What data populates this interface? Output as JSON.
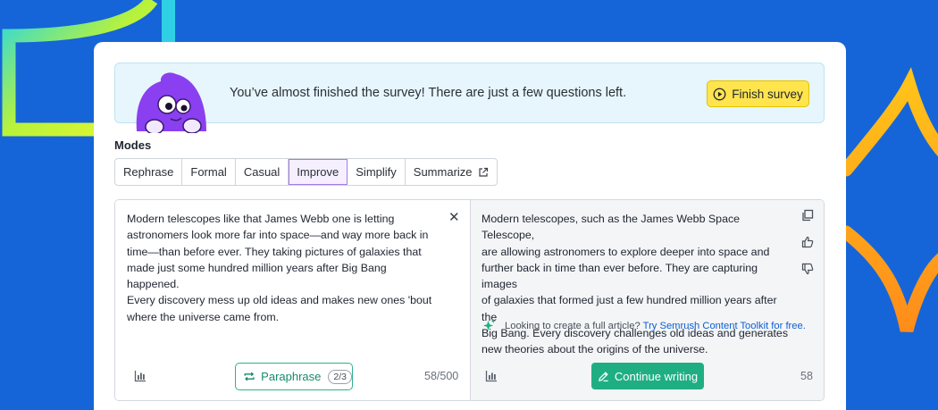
{
  "colors": {
    "background": "#1565d8",
    "finish_button": "#ffe44d",
    "paraphrase_accent": "#158a6b",
    "continue_button": "#1fae82",
    "active_mode": "#a47be8",
    "link": "#0b5fd6"
  },
  "banner": {
    "message": "You’ve almost finished the survey! There are just a few questions left.",
    "finish_label": "Finish survey",
    "finish_icon": "play-circle-icon",
    "mascot": "purple-mascot-illustration"
  },
  "modes": {
    "title": "Modes",
    "items": [
      {
        "label": "Rephrase",
        "active": false
      },
      {
        "label": "Formal",
        "active": false
      },
      {
        "label": "Casual",
        "active": false
      },
      {
        "label": "Improve",
        "active": true
      },
      {
        "label": "Simplify",
        "active": false
      },
      {
        "label": "Summarize",
        "active": false,
        "icon": "external-link-icon"
      }
    ]
  },
  "input": {
    "lines": [
      "Modern telescopes like that James Webb one is letting",
      "astronomers look more far into space—and way more back in",
      "time—than before ever. They taking pictures of galaxies that",
      "made just some hundred million years after Big Bang happened.",
      "Every discovery mess up old ideas and makes new ones 'bout",
      "where the universe came from."
    ],
    "close_icon": "close-icon",
    "stats_icon": "bar-chart-icon",
    "paraphrase_label": "Paraphrase",
    "paraphrase_count": "2/3",
    "char_count": "58/500"
  },
  "output": {
    "lines": [
      "Modern telescopes, such as the James Webb Space Telescope,",
      "are allowing astronomers to explore deeper into space and",
      "further back in time than ever before. They are capturing images",
      "of galaxies that formed just a few hundred million years after the",
      "Big Bang. Every discovery challenges old ideas and generates",
      "new theories about the origins of the universe."
    ],
    "actions": [
      "copy-icon",
      "thumbs-up-icon",
      "thumbs-down-icon"
    ],
    "toolkit_prompt": "Looking to create a full article?",
    "toolkit_link": "Try Semrush Content Toolkit for free.",
    "continue_label": "Continue writing",
    "word_count": "58"
  }
}
